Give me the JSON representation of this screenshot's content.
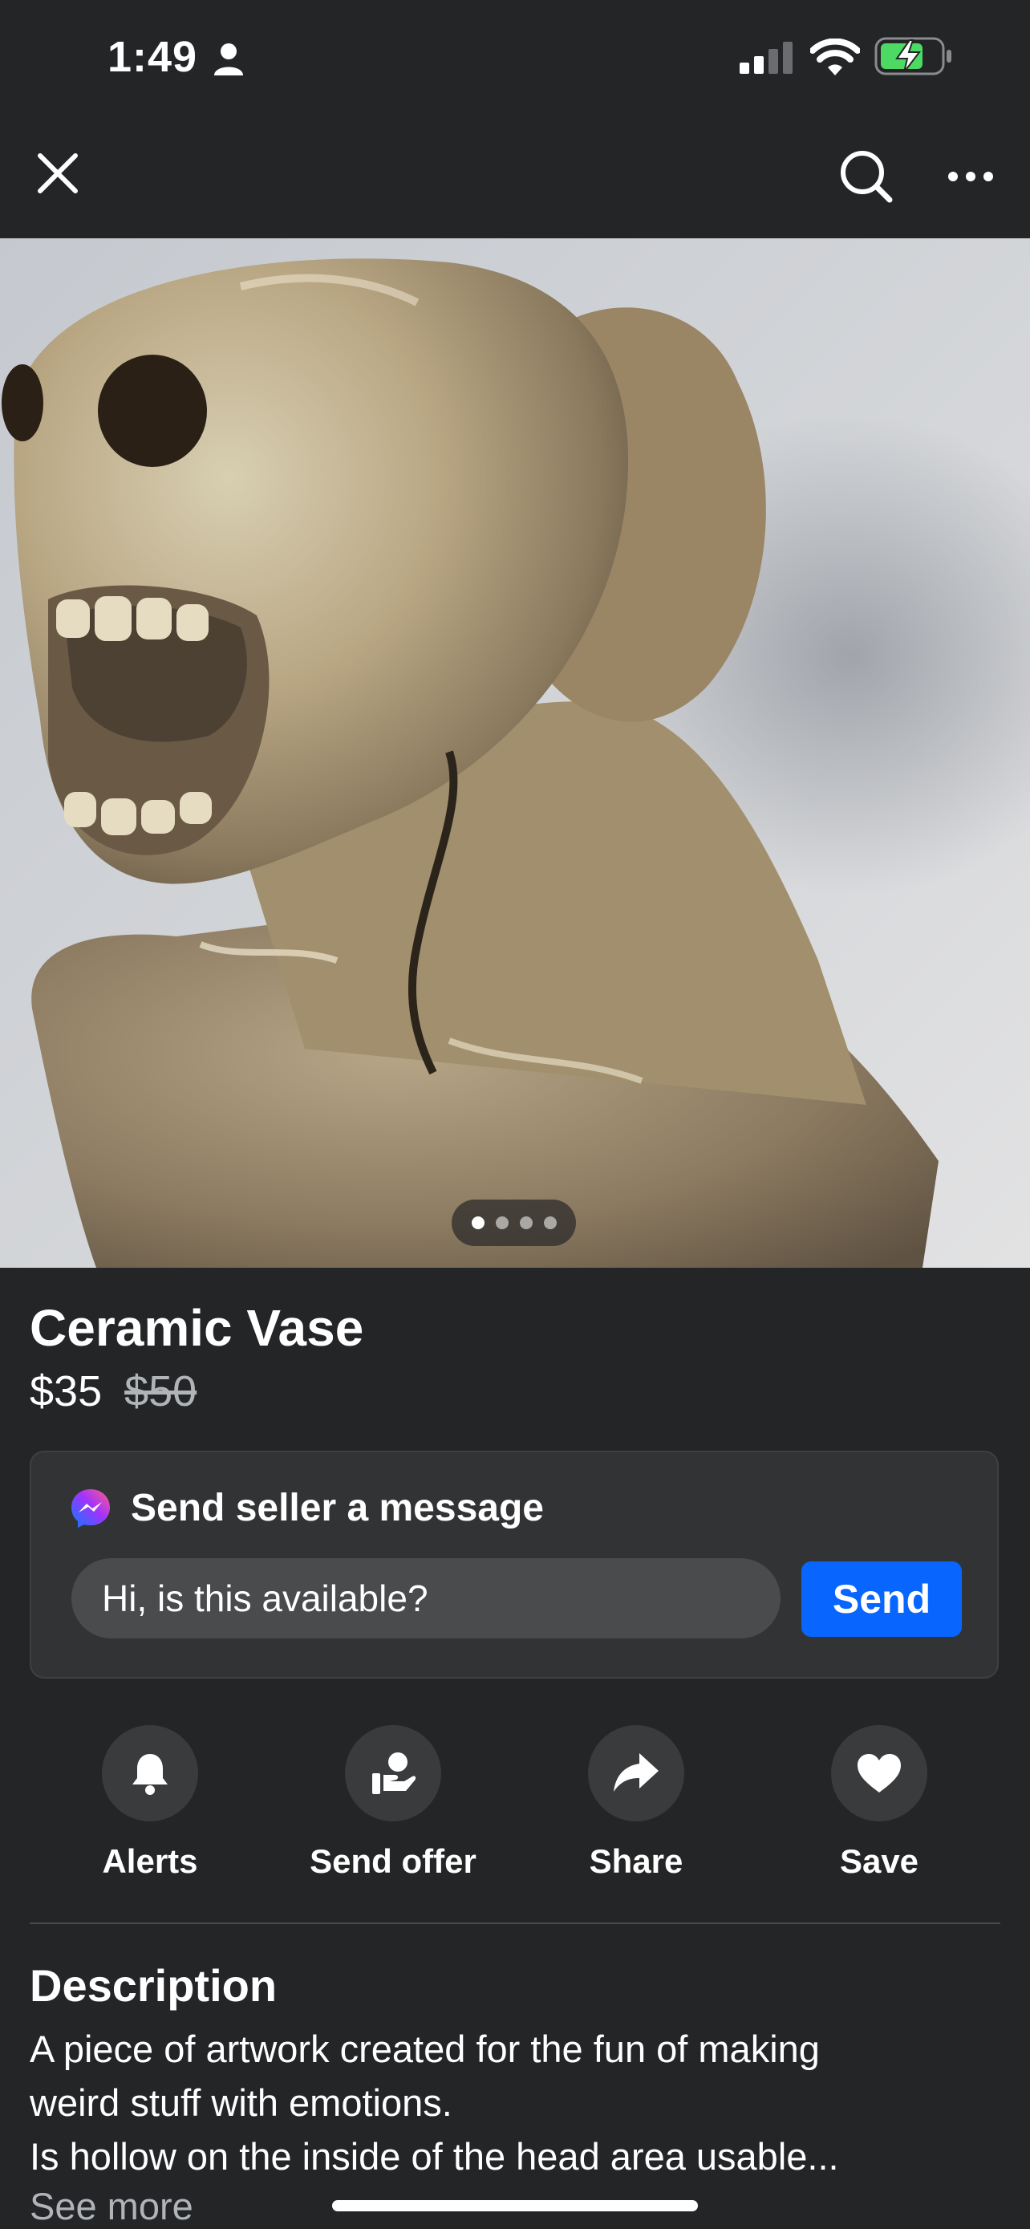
{
  "status_bar": {
    "time": "1:49",
    "signal_bars": 2,
    "battery_charging": true,
    "battery_level": 0.65,
    "battery_color": "#4cd964"
  },
  "nav": {
    "close_icon": "close-icon",
    "search_icon": "search-icon",
    "more_icon": "more-icon"
  },
  "photo": {
    "subject": "ceramic skull sculpture",
    "page_count": 4,
    "current_page": 1
  },
  "listing": {
    "title": "Ceramic Vase",
    "price": "$35",
    "original_price": "$50"
  },
  "message": {
    "title": "Send seller a message",
    "input_value": "Hi, is this available?",
    "send_label": "Send",
    "accent_color": "#0866ff",
    "icon": "messenger-icon"
  },
  "actions": [
    {
      "label": "Alerts",
      "icon": "bell-icon"
    },
    {
      "label": "Send offer",
      "icon": "offer-hand-icon"
    },
    {
      "label": "Share",
      "icon": "share-arrow-icon"
    },
    {
      "label": "Save",
      "icon": "heart-icon"
    }
  ],
  "description": {
    "heading": "Description",
    "lines": [
      "A piece of artwork created for the fun of making",
      "weird stuff with emotions.",
      "Is hollow on the inside of the head area usable..."
    ],
    "see_more": "See more"
  }
}
